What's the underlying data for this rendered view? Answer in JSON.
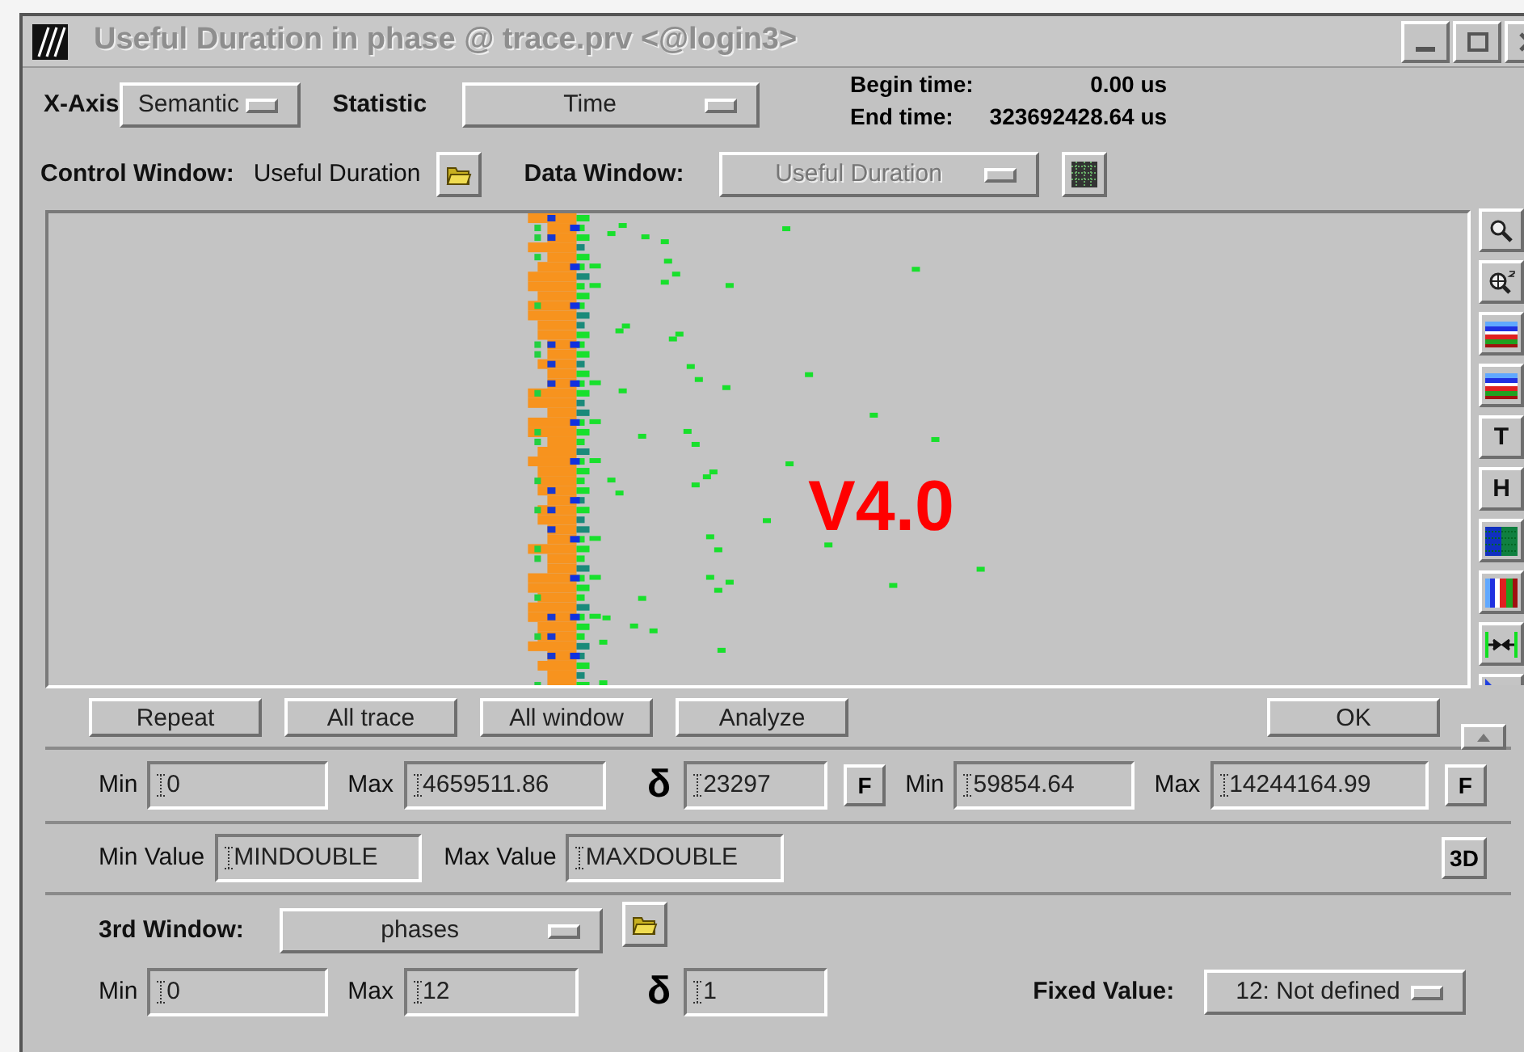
{
  "window": {
    "title": "Useful Duration in phase @ trace.prv <@login3>"
  },
  "header": {
    "x_axis_label": "X-Axis",
    "x_axis_value": "Semantic",
    "statistic_label": "Statistic",
    "statistic_value": "Time",
    "begin_label": "Begin time:",
    "begin_value": "0.00 us",
    "end_label": "End time:",
    "end_value": "323692428.64 us"
  },
  "control_window": {
    "label": "Control Window:",
    "value": "Useful Duration"
  },
  "data_window": {
    "label": "Data Window:",
    "value": "Useful Duration",
    "disabled": true
  },
  "plot": {
    "overlay": "V4.0"
  },
  "toolbar": [
    {
      "kind": "zoom"
    },
    {
      "kind": "zoom-plus"
    },
    {
      "kind": "bars"
    },
    {
      "kind": "bars"
    },
    {
      "kind": "letter",
      "label": "T"
    },
    {
      "kind": "letter",
      "label": "H"
    },
    {
      "kind": "gradient"
    },
    {
      "kind": "columns"
    },
    {
      "kind": "arrows"
    },
    {
      "kind": "partial"
    }
  ],
  "buttons": [
    "Repeat",
    "All trace",
    "All window",
    "Analyze"
  ],
  "ok_button": "OK",
  "range": {
    "min_label": "Min",
    "min": "0",
    "max_label": "Max",
    "max": "4659511.86",
    "delta_label": "δ",
    "delta": "23297",
    "f_button": "F",
    "min2_label": "Min",
    "min2": "59854.64",
    "max2_label": "Max",
    "max2": "14244164.99",
    "f2_button": "F"
  },
  "values": {
    "min_label": "Min Value",
    "min": "MINDOUBLE",
    "max_label": "Max Value",
    "max": "MAXDOUBLE",
    "button_3d": "3D"
  },
  "third_window": {
    "label": "3rd Window:",
    "value": "phases",
    "min_label": "Min",
    "min": "0",
    "max_label": "Max",
    "max": "12",
    "delta_label": "δ",
    "delta": "1",
    "fixed_label": "Fixed Value:",
    "fixed_value": "12: Not defined"
  }
}
